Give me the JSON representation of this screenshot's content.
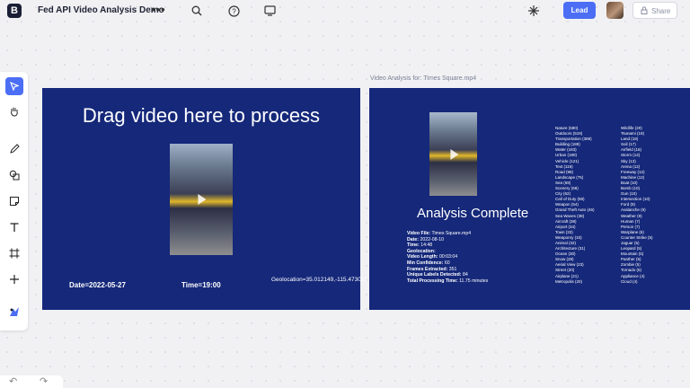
{
  "app": {
    "logo_text": "B",
    "board_title": "Fed API Video Analysis Demo"
  },
  "header": {
    "lead_label": "Lead",
    "share_label": "Share"
  },
  "toolbar": {
    "tools": [
      "select",
      "hand",
      "pen",
      "shapes",
      "sticky-note",
      "text",
      "frame",
      "add",
      "apps"
    ]
  },
  "frame": {
    "label": "Video Analysis for: Times Square.mp4"
  },
  "slide1": {
    "title": "Drag video here to process",
    "date": "Date=2022-05-27",
    "time": "Time=19:00",
    "geolocation": "Geolocation=35.012149,-115.473011"
  },
  "slide2": {
    "title": "Analysis Complete",
    "details": [
      {
        "key": "Video File:",
        "value": "Times Square.mp4"
      },
      {
        "key": "Date:",
        "value": "2022-08-10"
      },
      {
        "key": "Time:",
        "value": "14:48"
      },
      {
        "key": "Geolocation:",
        "value": ""
      },
      {
        "key": "Video Length:",
        "value": "00:03:04"
      },
      {
        "key": "Min Confidence:",
        "value": "60"
      },
      {
        "key": "Frames Extracted:",
        "value": "351"
      },
      {
        "key": "Unique Labels Detected:",
        "value": "84"
      },
      {
        "key": "Total Processing Time:",
        "value": "11.75 minutes"
      }
    ],
    "labels_col1": [
      "Nature (590)",
      "Outdoors (519)",
      "Transportation (388)",
      "Building (189)",
      "Water (183)",
      "Urban (180)",
      "Vehicle (121)",
      "Text (119)",
      "Road (98)",
      "Landscape (75)",
      "Sea (69)",
      "Scenery (68)",
      "City (62)",
      "Call of Duty (59)",
      "Weapon (54)",
      "Grand Theft Auto (46)",
      "Sea Waves (38)",
      "Aircraft (38)",
      "Airport (34)",
      "Town (33)",
      "Weaponry (33)",
      "Animal (32)",
      "Architecture (31)",
      "Ocean (30)",
      "Snow (28)",
      "Aerial View (23)",
      "Street (20)",
      "Airplane (21)",
      "Metropolis (20)"
    ],
    "labels_col2": [
      "Wildlife (20)",
      "Tsunami (19)",
      "Land (18)",
      "Soil (17)",
      "Airfield (16)",
      "Storm (14)",
      "Sky (13)",
      "Arena (12)",
      "Freeway (12)",
      "Machine (12)",
      "Boat (10)",
      "Bomb (10)",
      "Gun (10)",
      "Intersection (10)",
      "Ford (9)",
      "Avalanche (9)",
      "Weather (9)",
      "Human (7)",
      "Person (7)",
      "Warplane (6)",
      "Counter Strike (5)",
      "Jaguar (5)",
      "Leopard (5)",
      "Mountain (5)",
      "Panther (5)",
      "Zombie (5)",
      "Tornado (5)",
      "Appliance (4)",
      "Cloud (4)"
    ]
  },
  "colors": {
    "accent": "#4b6ef5",
    "slide_bg": "#15287a",
    "canvas_bg": "#f1f1f4"
  }
}
